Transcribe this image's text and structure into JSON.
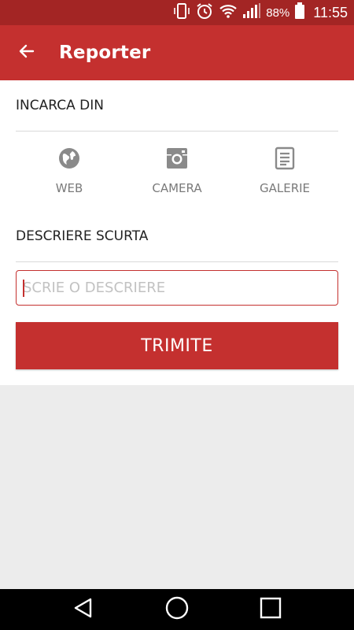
{
  "status_bar": {
    "battery_percent": "88%",
    "time": "11:55",
    "icons": [
      "vibrate-icon",
      "alarm-icon",
      "wifi-icon",
      "signal-icon",
      "battery-icon"
    ]
  },
  "app_bar": {
    "title": "Reporter",
    "back_icon": "arrow-left-icon"
  },
  "upload_section": {
    "label": "INCARCA DIN",
    "sources": [
      {
        "label": "WEB",
        "icon": "globe-icon"
      },
      {
        "label": "CAMERA",
        "icon": "camera-icon"
      },
      {
        "label": "GALERIE",
        "icon": "document-icon"
      }
    ]
  },
  "description_section": {
    "label": "DESCRIERE SCURTA",
    "input_value": "",
    "input_placeholder": "SCRIE O DESCRIERE"
  },
  "submit_button": {
    "label": "TRIMITE"
  },
  "nav_bar": {
    "icons": [
      "back-triangle-icon",
      "home-circle-icon",
      "recents-square-icon"
    ]
  },
  "colors": {
    "primary": "#c4302f",
    "status_bar": "#a32524",
    "background": "#ececec"
  }
}
